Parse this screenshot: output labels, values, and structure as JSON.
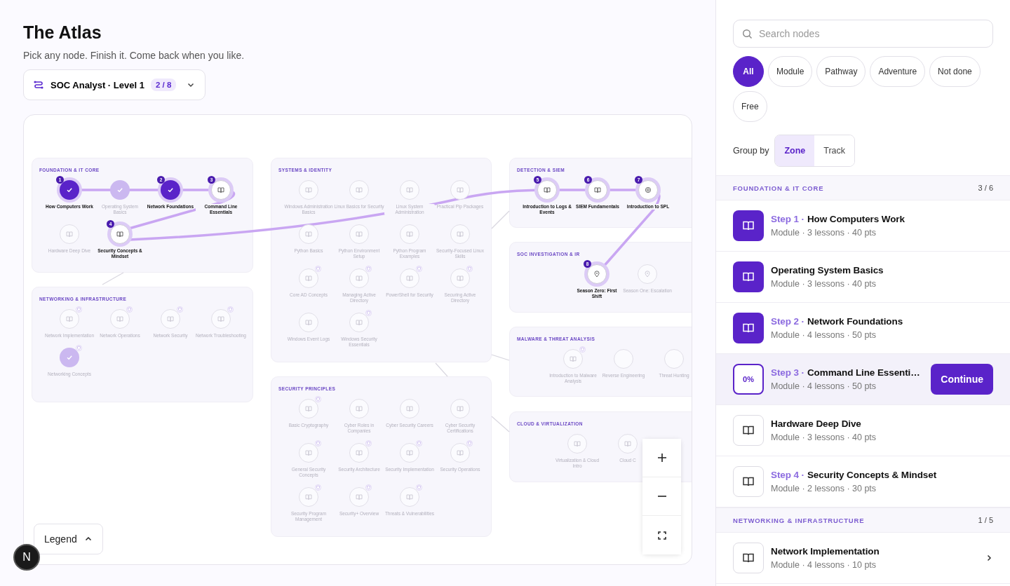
{
  "header": {
    "title": "The Atlas",
    "subtitle": "Pick any node. Finish it. Come back when you like.",
    "track": {
      "label": "SOC Analyst · Level 1",
      "progress": "2 / 8"
    }
  },
  "map": {
    "zones": [
      {
        "title": "FOUNDATION & IT CORE",
        "nodes": [
          {
            "label": "How Computers Work",
            "step": "1",
            "done": true,
            "highlight": true,
            "badge": false,
            "kind": "book"
          },
          {
            "label": "Operating System Basics",
            "done": true,
            "highlight": false,
            "badge": false,
            "kind": "book"
          },
          {
            "label": "Network Foundations",
            "step": "2",
            "done": true,
            "highlight": true,
            "badge": false,
            "kind": "book"
          },
          {
            "label": "Command Line Essentials",
            "step": "3",
            "done": false,
            "highlight": true,
            "badge": false,
            "kind": "book"
          },
          {
            "label": "Hardware Deep Dive",
            "done": false,
            "highlight": false,
            "badge": false,
            "kind": "book"
          },
          {
            "label": "Security Concepts & Mindset",
            "step": "4",
            "done": false,
            "highlight": true,
            "badge": false,
            "kind": "book"
          }
        ]
      },
      {
        "title": "NETWORKING & INFRASTRUCTURE",
        "nodes": [
          {
            "label": "Network Implementation",
            "done": false,
            "highlight": false,
            "badge": true,
            "kind": "book"
          },
          {
            "label": "Network Operations",
            "done": false,
            "highlight": false,
            "badge": true,
            "kind": "book"
          },
          {
            "label": "Network Security",
            "done": false,
            "highlight": false,
            "badge": true,
            "kind": "book"
          },
          {
            "label": "Network Troubleshooting",
            "done": false,
            "highlight": false,
            "badge": true,
            "kind": "book"
          },
          {
            "label": "Networking Concepts",
            "done": true,
            "highlight": false,
            "badge": true,
            "kind": "book"
          }
        ]
      },
      {
        "title": "SYSTEMS & IDENTITY",
        "nodes": [
          {
            "label": "Windows Administration Basics",
            "done": false,
            "highlight": false,
            "badge": false,
            "kind": "book"
          },
          {
            "label": "Linux Basics for Security",
            "done": false,
            "highlight": false,
            "badge": false,
            "kind": "book"
          },
          {
            "label": "Linux System Administration",
            "done": false,
            "highlight": false,
            "badge": false,
            "kind": "book"
          },
          {
            "label": "Practical Pip Packages",
            "done": false,
            "highlight": false,
            "badge": false,
            "kind": "book"
          },
          {
            "label": "Python Basics",
            "done": false,
            "highlight": false,
            "badge": false,
            "kind": "book"
          },
          {
            "label": "Python Environment Setup",
            "done": false,
            "highlight": false,
            "badge": false,
            "kind": "book"
          },
          {
            "label": "Python Program Examples",
            "done": false,
            "highlight": false,
            "badge": false,
            "kind": "book"
          },
          {
            "label": "Security-Focused Linux Skills",
            "done": false,
            "highlight": false,
            "badge": false,
            "kind": "book"
          },
          {
            "label": "Core AD Concepts",
            "done": false,
            "highlight": false,
            "badge": true,
            "kind": "book"
          },
          {
            "label": "Managing Active Directory",
            "done": false,
            "highlight": false,
            "badge": true,
            "kind": "book"
          },
          {
            "label": "PowerShell for Security",
            "done": false,
            "highlight": false,
            "badge": true,
            "kind": "book"
          },
          {
            "label": "Securing Active Directory",
            "done": false,
            "highlight": false,
            "badge": true,
            "kind": "book"
          },
          {
            "label": "Windows Event Logs",
            "done": false,
            "highlight": false,
            "badge": false,
            "kind": "book"
          },
          {
            "label": "Windows Security Essentials",
            "done": false,
            "highlight": false,
            "badge": true,
            "kind": "book"
          }
        ]
      },
      {
        "title": "SECURITY PRINCIPLES",
        "nodes": [
          {
            "label": "Basic Cryptography",
            "done": false,
            "highlight": false,
            "badge": true,
            "kind": "book"
          },
          {
            "label": "Cyber Roles in Companies",
            "done": false,
            "highlight": false,
            "badge": false,
            "kind": "book"
          },
          {
            "label": "Cyber Security Careers",
            "done": false,
            "highlight": false,
            "badge": false,
            "kind": "book"
          },
          {
            "label": "Cyber Security Certifications",
            "done": false,
            "highlight": false,
            "badge": false,
            "kind": "book"
          },
          {
            "label": "General Security Concepts",
            "done": false,
            "highlight": false,
            "badge": true,
            "kind": "book"
          },
          {
            "label": "Security Architecture",
            "done": false,
            "highlight": false,
            "badge": true,
            "kind": "book"
          },
          {
            "label": "Security Implementation",
            "done": false,
            "highlight": false,
            "badge": true,
            "kind": "book"
          },
          {
            "label": "Security Operations",
            "done": false,
            "highlight": false,
            "badge": true,
            "kind": "book"
          },
          {
            "label": "Security Program Management",
            "done": false,
            "highlight": false,
            "badge": true,
            "kind": "book"
          },
          {
            "label": "Security+ Overview",
            "done": false,
            "highlight": false,
            "badge": true,
            "kind": "book"
          },
          {
            "label": "Threats & Vulnerabilities",
            "done": false,
            "highlight": false,
            "badge": true,
            "kind": "book"
          }
        ]
      },
      {
        "title": "DETECTION & SIEM",
        "nodes": [
          {
            "label": "Introduction to Logs & Events",
            "step": "5",
            "done": false,
            "highlight": true,
            "badge": false,
            "kind": "book"
          },
          {
            "label": "SIEM Fundamentals",
            "step": "6",
            "done": false,
            "highlight": true,
            "badge": false,
            "kind": "book"
          },
          {
            "label": "Introduction to SPL",
            "step": "7",
            "done": false,
            "highlight": true,
            "badge": false,
            "kind": "target"
          }
        ]
      },
      {
        "title": "SOC INVESTIGATION & IR",
        "nodes": [
          {
            "label": "Season Zero: First Shift",
            "step": "8",
            "done": false,
            "highlight": true,
            "badge": false,
            "kind": "pin"
          },
          {
            "label": "Season One: Escalation",
            "done": false,
            "highlight": false,
            "badge": false,
            "kind": "pin"
          }
        ]
      },
      {
        "title": "MALWARE & THREAT ANALYSIS",
        "nodes": [
          {
            "label": "Introduction to Malware Analysis",
            "done": false,
            "highlight": false,
            "badge": true,
            "kind": "book"
          },
          {
            "label": "Reverse Engineering",
            "done": false,
            "highlight": false,
            "badge": false,
            "kind": "dashed"
          },
          {
            "label": "Threat Hunting",
            "done": false,
            "highlight": false,
            "badge": false,
            "kind": "dashed"
          }
        ]
      },
      {
        "title": "CLOUD & VIRTUALIZATION",
        "nodes": [
          {
            "label": "Virtualization & Cloud Intro",
            "done": false,
            "highlight": false,
            "badge": false,
            "kind": "book"
          },
          {
            "label": "Cloud C",
            "done": false,
            "highlight": false,
            "badge": false,
            "kind": "book"
          }
        ]
      }
    ],
    "legend": "Legend"
  },
  "dev_badge": "N",
  "sidebar": {
    "search": {
      "placeholder": "Search nodes"
    },
    "filters": [
      {
        "label": "All",
        "selected": true
      },
      {
        "label": "Module",
        "selected": false
      },
      {
        "label": "Pathway",
        "selected": false
      },
      {
        "label": "Adventure",
        "selected": false
      },
      {
        "label": "Not done",
        "selected": false
      },
      {
        "label": "Free",
        "selected": false
      }
    ],
    "group_by": {
      "label": "Group by",
      "options": [
        {
          "label": "Zone",
          "selected": true
        },
        {
          "label": "Track",
          "selected": false
        }
      ]
    },
    "sections": [
      {
        "title": "FOUNDATION & IT CORE",
        "count": "3 / 6",
        "rows": [
          {
            "step": "Step 1 ·",
            "title": "How Computers Work",
            "meta": "Module · 3 lessons · 40 pts",
            "done": true,
            "selected": false,
            "chevron": false
          },
          {
            "title": "Operating System Basics",
            "meta": "Module · 3 lessons · 40 pts",
            "done": true,
            "selected": false,
            "chevron": false
          },
          {
            "step": "Step 2 ·",
            "title": "Network Foundations",
            "meta": "Module · 4 lessons · 50 pts",
            "done": true,
            "selected": false,
            "chevron": false
          },
          {
            "step": "Step 3 ·",
            "title": "Command Line Essenti…",
            "meta": "Module · 4 lessons · 50 pts",
            "done": false,
            "progress": "0%",
            "action": "Continue",
            "selected": true,
            "chevron": false
          },
          {
            "title": "Hardware Deep Dive",
            "meta": "Module · 3 lessons · 40 pts",
            "done": false,
            "selected": false,
            "chevron": false
          },
          {
            "step": "Step 4 ·",
            "title": "Security Concepts & Mindset",
            "meta": "Module · 2 lessons · 30 pts",
            "done": false,
            "selected": false,
            "chevron": false
          }
        ]
      },
      {
        "title": "NETWORKING & INFRASTRUCTURE",
        "count": "1 / 5",
        "rows": [
          {
            "title": "Network Implementation",
            "meta": "Module · 4 lessons · 10 pts",
            "done": false,
            "selected": false,
            "chevron": true
          }
        ]
      }
    ]
  }
}
